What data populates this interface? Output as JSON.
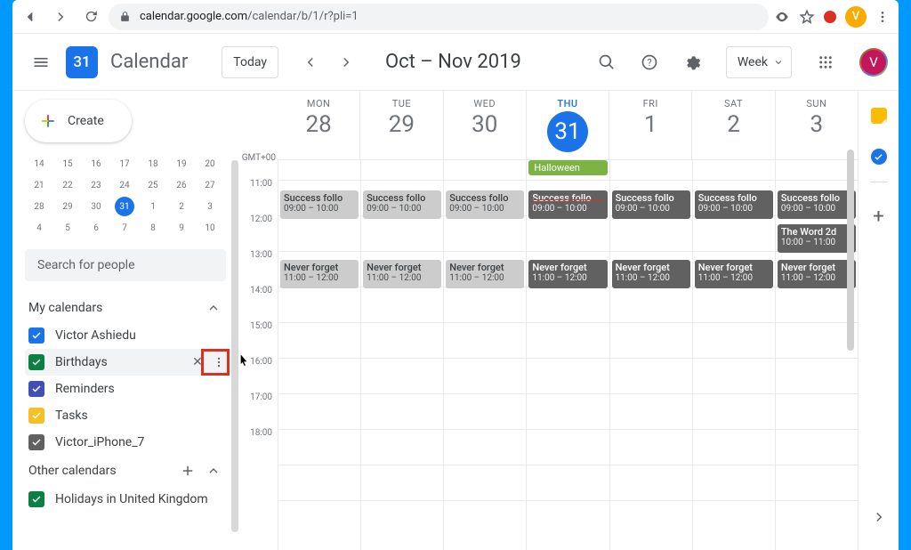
{
  "browser": {
    "url_host": "calendar.google.com",
    "url_path": "/calendar/b/1/r?pli=1",
    "avatar_letter": "V"
  },
  "header": {
    "logo_day": "31",
    "app_name": "Calendar",
    "today_label": "Today",
    "date_range": "Oct – Nov 2019",
    "view_label": "Week",
    "avatar_letter": "V"
  },
  "sidebar": {
    "create_label": "Create",
    "mini_cal": {
      "rows": [
        [
          "14",
          "15",
          "16",
          "17",
          "18",
          "19",
          "20"
        ],
        [
          "21",
          "22",
          "23",
          "24",
          "25",
          "26",
          "27"
        ],
        [
          "28",
          "29",
          "30",
          "31",
          "1",
          "2",
          "3"
        ],
        [
          "4",
          "5",
          "6",
          "7",
          "8",
          "9",
          "10"
        ]
      ],
      "today": "31"
    },
    "search_placeholder": "Search for people",
    "my_calendars_label": "My calendars",
    "my_calendars": [
      {
        "label": "Victor Ashiedu",
        "color": "#1a73e8"
      },
      {
        "label": "Birthdays",
        "color": "#0b8043",
        "hovered": true
      },
      {
        "label": "Reminders",
        "color": "#3f51b5"
      },
      {
        "label": "Tasks",
        "color": "#f6bf26"
      },
      {
        "label": "Victor_iPhone_7",
        "color": "#616161"
      }
    ],
    "other_calendars_label": "Other calendars",
    "other_calendars": [
      {
        "label": "Holidays in United Kingdom",
        "color": "#0b8043"
      }
    ]
  },
  "grid": {
    "tz": "GMT+00",
    "days": [
      {
        "dow": "MON",
        "num": "28",
        "today": false
      },
      {
        "dow": "TUE",
        "num": "29",
        "today": false
      },
      {
        "dow": "WED",
        "num": "30",
        "today": false
      },
      {
        "dow": "THU",
        "num": "31",
        "today": true
      },
      {
        "dow": "FRI",
        "num": "1",
        "today": false
      },
      {
        "dow": "SAT",
        "num": "2",
        "today": false
      },
      {
        "dow": "SUN",
        "num": "3",
        "today": false
      }
    ],
    "allday": {
      "col": 3,
      "label": "Halloween"
    },
    "hours": [
      "11:00",
      "12:00",
      "13:00",
      "14:00",
      "15:00",
      "16:00",
      "17:00",
      "18:00"
    ],
    "events_row1": {
      "title": "Success follo",
      "time": "09:00 – 10:00"
    },
    "events_row2": {
      "title": "Never forget",
      "time": "11:00 – 12:00"
    },
    "extra_event": {
      "title": "The Word 2d",
      "time": "10:00 – 11:00",
      "col": 6
    }
  }
}
